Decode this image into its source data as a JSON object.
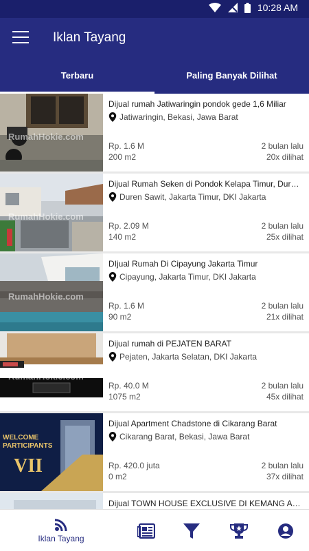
{
  "status": {
    "time": "10:28 AM"
  },
  "header": {
    "title": "Iklan Tayang"
  },
  "tabs": [
    {
      "label": "Terbaru",
      "active": true
    },
    {
      "label": "Paling Banyak Dilihat",
      "active": false
    }
  ],
  "watermark": "RumahHokie.com",
  "listings": [
    {
      "title": "Dijual rumah Jatiwaringin pondok gede 1,6 Miliar",
      "location": "Jatiwaringin, Bekasi, Jawa Barat",
      "price": "Rp. 1.6 M",
      "size": "200 m2",
      "posted": "2 bulan lalu",
      "views": "20x dilihat"
    },
    {
      "title": "Dijual Rumah Seken di Pondok Kelapa Timur, Duren Sawit",
      "location": "Duren Sawit, Jakarta Timur, DKI Jakarta",
      "price": "Rp. 2.09 M",
      "size": "140 m2",
      "posted": "2 bulan lalu",
      "views": "25x dilihat"
    },
    {
      "title": "DIjual Rumah Di Cipayung Jakarta Timur",
      "location": "Cipayung, Jakarta Timur, DKI Jakarta",
      "price": "Rp. 1.6 M",
      "size": "90 m2",
      "posted": "2 bulan lalu",
      "views": "21x dilihat"
    },
    {
      "title": "Dijual rumah di PEJATEN BARAT",
      "location": "Pejaten, Jakarta Selatan, DKI Jakarta",
      "price": "Rp. 40.0 M",
      "size": "1075 m2",
      "posted": "2 bulan lalu",
      "views": "45x dilihat"
    },
    {
      "title": "Dijual Apartment Chadstone di Cikarang Barat",
      "location": "Cikarang Barat, Bekasi, Jawa Barat",
      "price": "Rp. 420.0 juta",
      "size": "0 m2",
      "posted": "2 bulan lalu",
      "views": "37x dilihat"
    },
    {
      "title": "Dijual  TOWN HOUSE EXCLUSIVE DI KEMANG AMPERA",
      "location": "",
      "price": "",
      "size": "",
      "posted": "",
      "views": ""
    }
  ],
  "banner": {
    "line1": "WELCOME",
    "line2": "PARTICIPANTS",
    "line3": "VII"
  },
  "bottom_nav": [
    {
      "label": "Iklan Tayang",
      "icon": "rss-icon"
    },
    {
      "icon": "newspaper-icon"
    },
    {
      "icon": "filter-icon"
    },
    {
      "icon": "trophy-icon"
    },
    {
      "icon": "account-icon"
    }
  ],
  "colors": {
    "primary": "#262c80",
    "status_bar": "#1a1f6b"
  }
}
